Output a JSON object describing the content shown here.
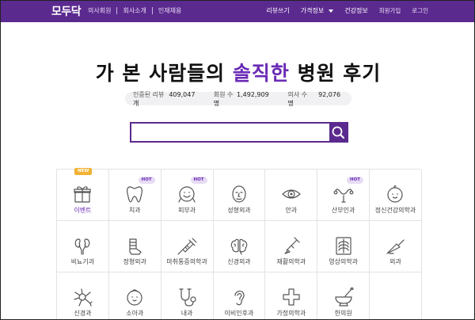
{
  "header": {
    "logo": "모두닥",
    "left_nav": [
      "의사회원",
      "회사소개",
      "인재채용"
    ],
    "right_nav": {
      "review": "리뷰쓰기",
      "price_info": "가격정보",
      "health_info": "건강정보",
      "signup": "회원가입",
      "login": "로그인"
    },
    "brand_color": "#5b2a8f"
  },
  "hero": {
    "title_pre": "가 본 사람들의 ",
    "title_accent": "솔직한",
    "title_post": " 병원 후기",
    "accent_color": "#6a2bb5"
  },
  "stats": [
    {
      "label": "인증된 리뷰",
      "value": "409,047개"
    },
    {
      "label": "회원 수",
      "value": "1,492,909명"
    },
    {
      "label": "의사 수",
      "value": "92,076명"
    }
  ],
  "search": {
    "value": "",
    "placeholder": "",
    "icon": "search-icon"
  },
  "categories": [
    {
      "label": "이벤트",
      "icon": "gift-icon",
      "badge": "NEW"
    },
    {
      "label": "치과",
      "icon": "tooth-icon",
      "badge": "HOT"
    },
    {
      "label": "피부과",
      "icon": "skin-face-icon",
      "badge": "HOT"
    },
    {
      "label": "성형외과",
      "icon": "plastic-face-icon",
      "badge": ""
    },
    {
      "label": "안과",
      "icon": "eye-icon",
      "badge": ""
    },
    {
      "label": "산부인과",
      "icon": "uterus-icon",
      "badge": "HOT"
    },
    {
      "label": "정신건강의학과",
      "icon": "baby-face-icon",
      "badge": ""
    },
    {
      "label": "비뇨기과",
      "icon": "kidney-icon",
      "badge": ""
    },
    {
      "label": "정형외과",
      "icon": "cast-icon",
      "badge": ""
    },
    {
      "label": "마취통증의학과",
      "icon": "syringe-icon",
      "badge": ""
    },
    {
      "label": "신경외과",
      "icon": "brain-icon",
      "badge": ""
    },
    {
      "label": "재활의학과",
      "icon": "crutch-icon",
      "badge": ""
    },
    {
      "label": "영상의학과",
      "icon": "xray-icon",
      "badge": ""
    },
    {
      "label": "외과",
      "icon": "scalpel-icon",
      "badge": ""
    },
    {
      "label": "신경과",
      "icon": "neuron-icon",
      "badge": ""
    },
    {
      "label": "소아과",
      "icon": "child-face-icon",
      "badge": ""
    },
    {
      "label": "내과",
      "icon": "stethoscope-icon",
      "badge": ""
    },
    {
      "label": "이비인후과",
      "icon": "ear-icon",
      "badge": ""
    },
    {
      "label": "가정의학과",
      "icon": "cross-icon",
      "badge": ""
    },
    {
      "label": "한의원",
      "icon": "mortar-icon",
      "badge": ""
    }
  ]
}
